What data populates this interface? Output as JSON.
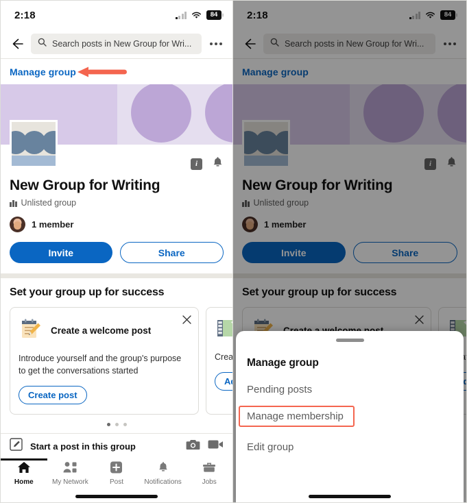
{
  "status": {
    "time": "2:18",
    "battery": "84",
    "signal_icon": "cell-signal-icon",
    "wifi_icon": "wifi-icon"
  },
  "header": {
    "back_icon": "back-arrow-icon",
    "search_placeholder": "Search posts in New Group for Wri...",
    "search_icon": "search-icon",
    "overflow_icon": "kebab-menu-icon"
  },
  "manage_row": {
    "link_label": "Manage group",
    "annotation_icon": "red-arrow-annotation"
  },
  "group": {
    "logo_icon": "group-logo-image",
    "info_icon": "info-icon",
    "bell_icon": "notification-bell-icon",
    "title": "New Group for Writing",
    "privacy_icon": "unlisted-group-icon",
    "privacy_label": "Unlisted group",
    "member_count_label": "1 member",
    "avatar_icon": "member-avatar",
    "invite_label": "Invite",
    "share_label": "Share"
  },
  "success": {
    "heading": "Set your group up for success",
    "cards": [
      {
        "icon": "memo-pencil-icon",
        "title": "Create a welcome post",
        "description": "Introduce yourself and the group's purpose to get the conversations started",
        "button_label": "Create post",
        "close_icon": "close-icon"
      },
      {
        "icon": "green-chart-icon",
        "description": "Create posts",
        "button_label": "Add"
      }
    ],
    "pager": {
      "total": 3,
      "active": 0
    }
  },
  "composer": {
    "compose_icon": "compose-pencil-icon",
    "label": "Start a post in this group",
    "camera_icon": "camera-icon",
    "video_icon": "video-camera-icon"
  },
  "bottom_nav": [
    {
      "label": "Home",
      "icon": "home-icon",
      "active": true
    },
    {
      "label": "My Network",
      "icon": "my-network-icon",
      "active": false
    },
    {
      "label": "Post",
      "icon": "post-plus-icon",
      "active": false
    },
    {
      "label": "Notifications",
      "icon": "bell-icon",
      "active": false
    },
    {
      "label": "Jobs",
      "icon": "briefcase-icon",
      "active": false
    }
  ],
  "sheet": {
    "grabber_icon": "drag-handle-icon",
    "title": "Manage group",
    "items": [
      {
        "label": "Pending posts",
        "highlighted": false
      },
      {
        "label": "Manage membership",
        "highlighted": true
      },
      {
        "label": "Edit group",
        "highlighted": false
      }
    ]
  },
  "colors": {
    "accent_blue": "#0a66c2",
    "annotation_red": "#f4654f",
    "banner_light": "#e5deef",
    "banner_block": "#d7c9e8",
    "banner_circle": "#bca6d6"
  }
}
